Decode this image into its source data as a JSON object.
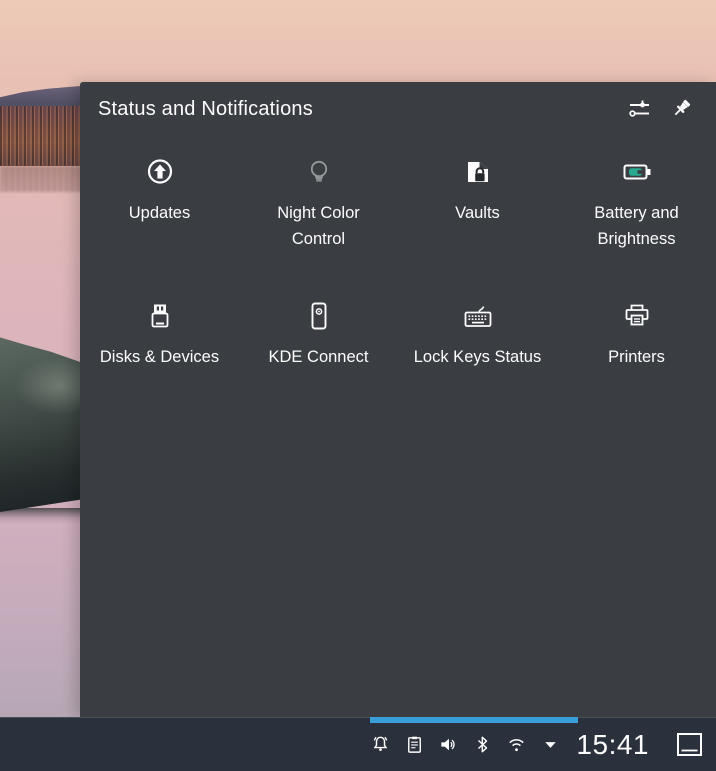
{
  "popup": {
    "title": "Status and Notifications",
    "header_icons": [
      {
        "name": "configure",
        "label": "Configure Status and Notifications"
      },
      {
        "name": "pin",
        "label": "Keep Open"
      }
    ],
    "items": [
      {
        "label": "Updates",
        "icon": "updates-icon"
      },
      {
        "label": "Night Color Control",
        "icon": "lightbulb-icon",
        "state": "inactive"
      },
      {
        "label": "Vaults",
        "icon": "vault-lock-icon"
      },
      {
        "label": "Battery and Brightness",
        "icon": "battery-charging-icon"
      },
      {
        "label": "Disks & Devices",
        "icon": "usb-drive-icon"
      },
      {
        "label": "KDE Connect",
        "icon": "smartphone-icon"
      },
      {
        "label": "Lock Keys Status",
        "icon": "keyboard-icon"
      },
      {
        "label": "Printers",
        "icon": "printer-icon"
      }
    ]
  },
  "taskbar": {
    "clock": "15:41",
    "tray_icons": [
      "notifications-bell",
      "clipboard",
      "volume",
      "bluetooth",
      "wifi",
      "expand-caret"
    ],
    "show_desktop": "show-desktop"
  },
  "colors": {
    "popup_bg": "#3a3e43",
    "taskbar_bg": "#2b313c",
    "accent": "#3a9fd9",
    "text": "#fcfcfc",
    "battery_fill": "#2aa890",
    "dimmed_icon": "#97999c"
  }
}
